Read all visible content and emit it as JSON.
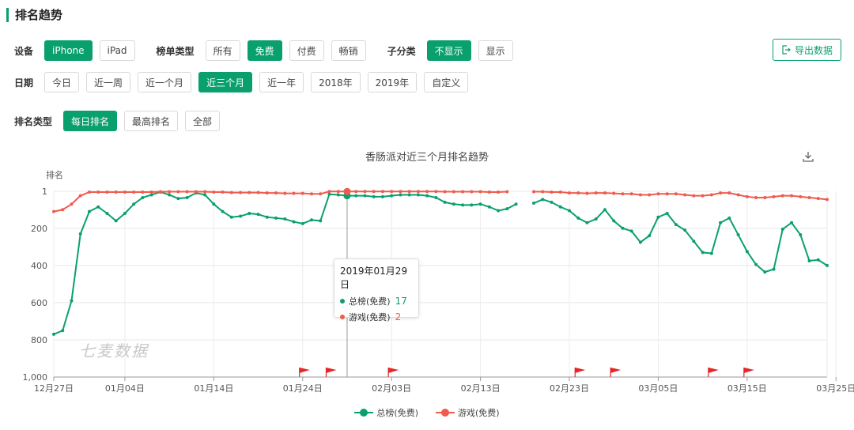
{
  "header": {
    "title": "排名趋势"
  },
  "filters": {
    "device_label": "设备",
    "devices": [
      "iPhone",
      "iPad"
    ],
    "device_active": 0,
    "list_type_label": "榜单类型",
    "list_types": [
      "所有",
      "免费",
      "付费",
      "畅销"
    ],
    "list_type_active": 1,
    "subcat_label": "子分类",
    "subcats": [
      "不显示",
      "显示"
    ],
    "subcat_active": 0,
    "date_label": "日期",
    "dates": [
      "今日",
      "近一周",
      "近一个月",
      "近三个月",
      "近一年",
      "2018年",
      "2019年",
      "自定义"
    ],
    "date_active": 3,
    "rank_type_label": "排名类型",
    "rank_types": [
      "每日排名",
      "最高排名",
      "全部"
    ],
    "rank_type_active": 0
  },
  "export": {
    "label": "导出数据",
    "icon": "export-icon"
  },
  "watermark": "七麦数据",
  "tooltip": {
    "date": "2019年01月29日",
    "rows": [
      {
        "name": "总榜(免费)",
        "value": "17",
        "color": "#0aa06e"
      },
      {
        "name": "游戏(免费)",
        "value": "2",
        "color": "#ee5b4f"
      }
    ]
  },
  "chart_data": {
    "type": "line",
    "title": "香肠派对近三个月排名趋势",
    "ylabel": "排名",
    "y_inverted": true,
    "ylim": [
      1,
      1000
    ],
    "yticks": [
      "1",
      "200",
      "400",
      "600",
      "800",
      "1,000"
    ],
    "ytick_values": [
      1,
      200,
      400,
      600,
      800,
      1000
    ],
    "xticks": [
      "12月27日",
      "01月04日",
      "01月14日",
      "01月24日",
      "02月03日",
      "02月13日",
      "02月23日",
      "03月05日",
      "03月15日",
      "03月25日"
    ],
    "x_start": "2018-12-27",
    "x_end": "2019-03-30",
    "grid": true,
    "legend_position": "bottom",
    "series": [
      {
        "name": "总榜(免费)",
        "color": "#0aa06e",
        "values": [
          770,
          750,
          590,
          230,
          110,
          85,
          120,
          160,
          120,
          70,
          35,
          20,
          5,
          20,
          40,
          35,
          10,
          20,
          70,
          110,
          140,
          135,
          120,
          125,
          140,
          145,
          150,
          165,
          175,
          155,
          160,
          17,
          20,
          25,
          25,
          25,
          30,
          30,
          25,
          20,
          20,
          20,
          25,
          35,
          60,
          70,
          75,
          75,
          70,
          85,
          105,
          95,
          70,
          null,
          65,
          45,
          60,
          85,
          105,
          145,
          170,
          150,
          100,
          160,
          200,
          215,
          275,
          240,
          140,
          120,
          180,
          210,
          270,
          330,
          335,
          170,
          145,
          235,
          325,
          395,
          435,
          420,
          205,
          170,
          235,
          375,
          370,
          400
        ],
        "gaps": []
      },
      {
        "name": "游戏(免费)",
        "color": "#ee5b4f",
        "values": [
          110,
          100,
          70,
          25,
          5,
          5,
          5,
          5,
          5,
          5,
          5,
          5,
          3,
          3,
          3,
          3,
          3,
          3,
          5,
          5,
          8,
          8,
          8,
          8,
          10,
          10,
          12,
          12,
          12,
          15,
          15,
          2,
          2,
          2,
          2,
          2,
          2,
          2,
          2,
          2,
          2,
          2,
          2,
          2,
          3,
          3,
          3,
          3,
          3,
          5,
          5,
          3,
          null,
          null,
          3,
          3,
          5,
          5,
          10,
          10,
          12,
          10,
          10,
          12,
          15,
          15,
          20,
          20,
          15,
          15,
          15,
          20,
          25,
          25,
          20,
          10,
          10,
          20,
          30,
          35,
          35,
          30,
          25,
          25,
          30,
          35,
          40,
          45
        ],
        "gaps": []
      }
    ],
    "flags": [
      "01月24日",
      "01月27日",
      "02月03日",
      "02月24日",
      "02月28日",
      "03月11日",
      "03月15日"
    ]
  }
}
